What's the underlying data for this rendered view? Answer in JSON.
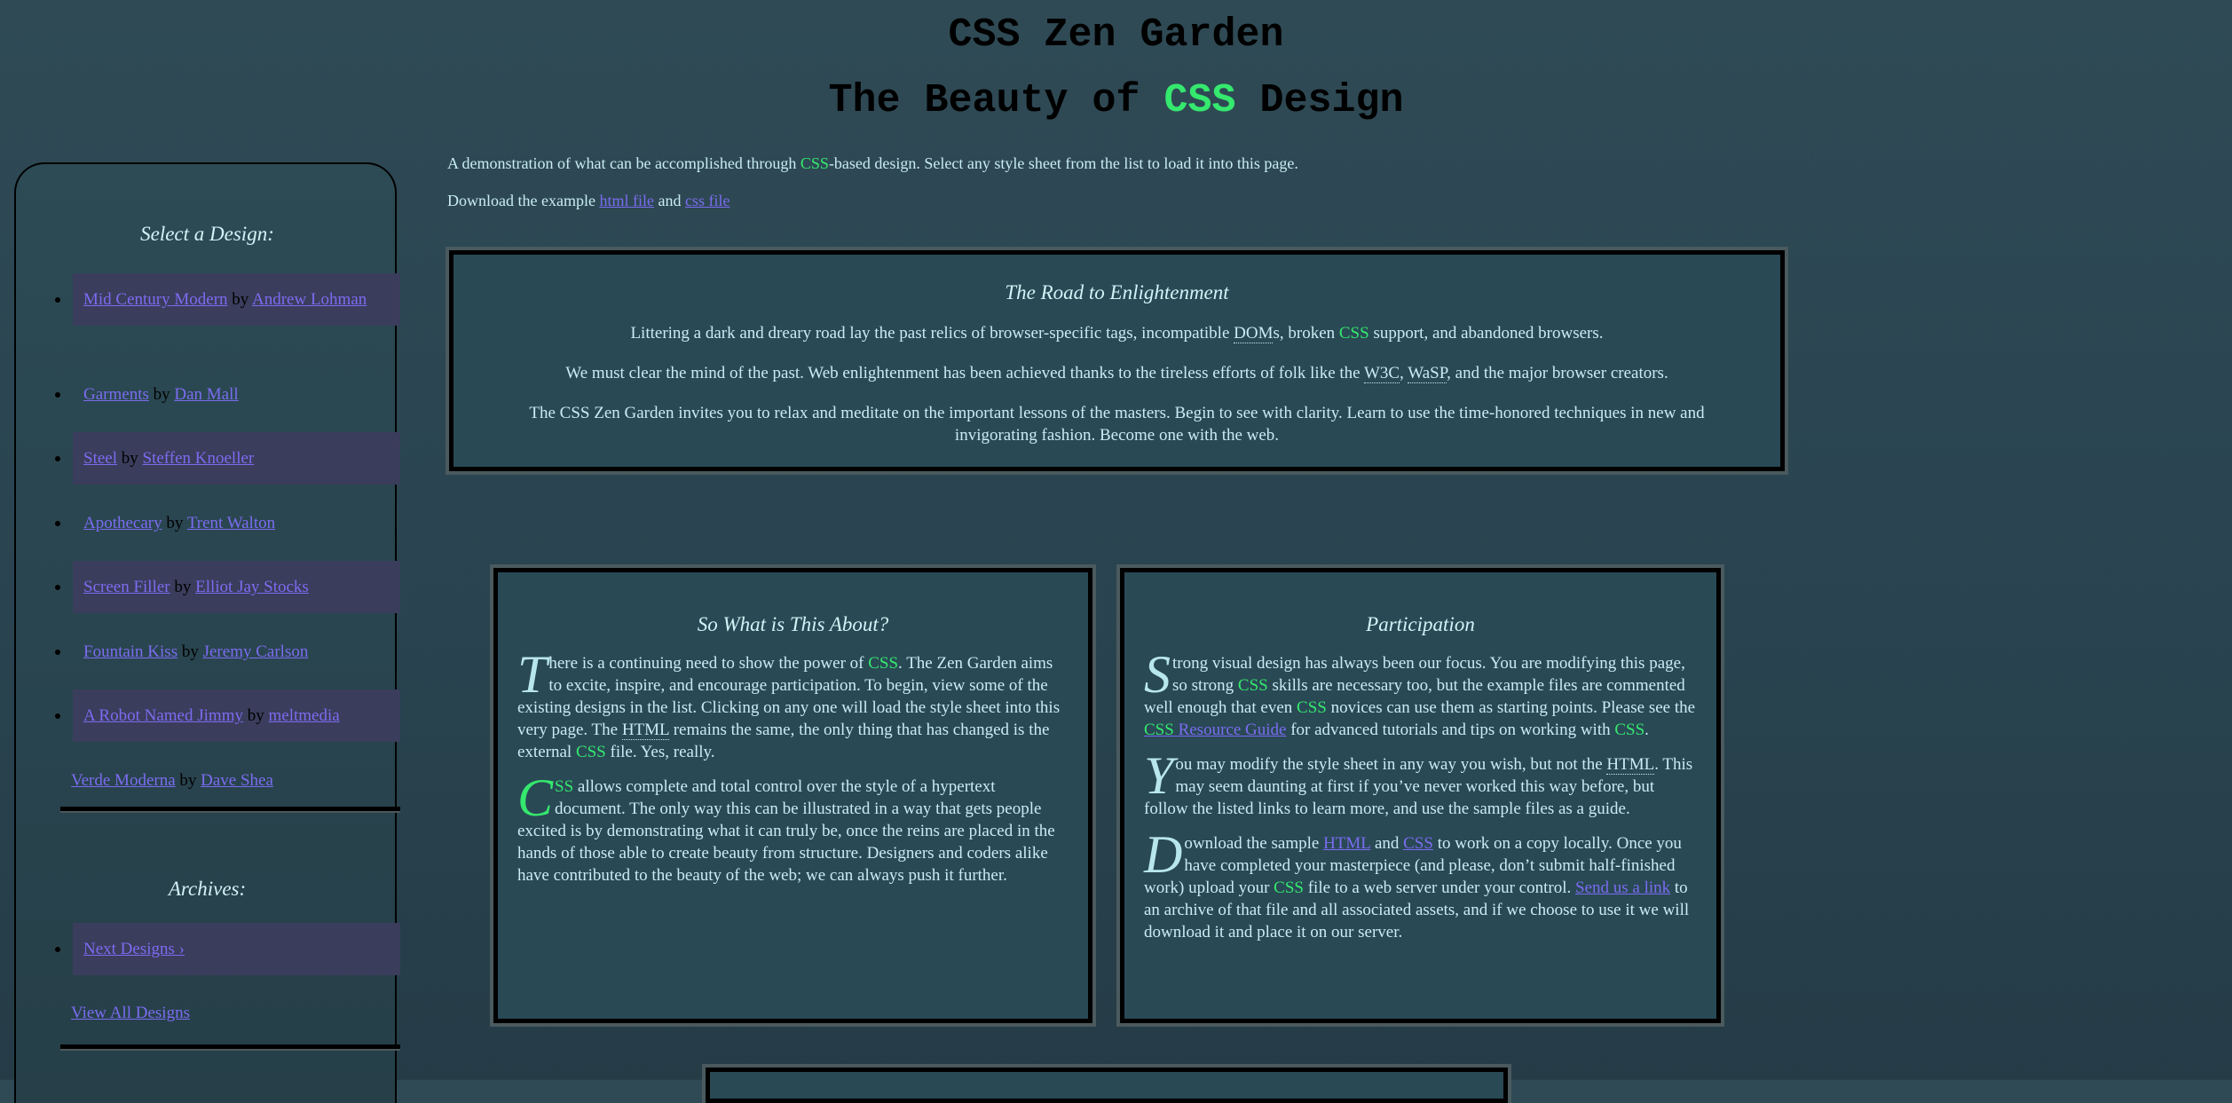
{
  "header": {
    "title": "CSS Zen Garden",
    "subtitle_pre": "The Beauty of ",
    "subtitle_css": "CSS",
    "subtitle_post": " Design"
  },
  "intro": {
    "line1_pre": "A demonstration of what can be accomplished through ",
    "line1_css": "CSS",
    "line1_post": "-based design. Select any style sheet from the list to load it into this page.",
    "line2_pre": "Download the example ",
    "html_file_link": "html file",
    "and": " and ",
    "css_file_link": "css file"
  },
  "road": {
    "title": "The Road to Enlightenment",
    "p1_pre": "Littering a dark and dreary road lay the past relics of browser-specific tags, incompatible ",
    "p1_dom": "DOM",
    "p1_mid": "s, broken ",
    "p1_css": "CSS",
    "p1_post": " support, and abandoned browsers.",
    "p2_pre": "We must clear the mind of the past. Web enlightenment has been achieved thanks to the tireless efforts of folk like the ",
    "p2_w3c": "W3C",
    "p2_comma": ", ",
    "p2_wasp": "WaSP",
    "p2_post": ", and the major browser creators.",
    "p3": "The CSS Zen Garden invites you to relax and meditate on the important lessons of the masters. Begin to see with clarity. Learn to use the time-honored techniques in new and invigorating fashion. Become one with the web."
  },
  "about": {
    "title": "So What is This About?",
    "p1_drop": "T",
    "p1_a": "here is a continuing need to show the power of ",
    "p1_css": "CSS",
    "p1_b": ". The Zen Garden aims to excite, inspire, and encourage participation. To begin, view some of the existing designs in the list. Clicking on any one will load the style sheet into this very page. The ",
    "p1_html": "HTML",
    "p1_c": " remains the same, the only thing that has changed is the external ",
    "p1_css2": "CSS",
    "p1_d": " file. Yes, really.",
    "p2_drop": "C",
    "p2_css_rest": "SS",
    "p2_a": " allows complete and total control over the style of a hypertext document. The only way this can be illustrated in a way that gets people excited is by demonstrating what it can truly be, once the reins are placed in the hands of those able to create beauty from structure. Designers and coders alike have contributed to the beauty of the web; we can always push it further."
  },
  "participation": {
    "title": "Participation",
    "p1_drop": "S",
    "p1_a": "trong visual design has always been our focus. You are modifying this page, so strong ",
    "p1_css": "CSS",
    "p1_b": " skills are necessary too, but the example files are commented well enough that even ",
    "p1_css2": "CSS",
    "p1_c": " novices can use them as starting points. Please see the ",
    "p1_link_css": "CSS",
    "p1_link_rest": " Resource Guide",
    "p1_d": " for advanced tutorials and tips on working with ",
    "p1_css3": "CSS",
    "p1_e": ".",
    "p2_drop": "Y",
    "p2_a": "ou may modify the style sheet in any way you wish, but not the ",
    "p2_html": "HTML",
    "p2_b": ". This may seem daunting at first if you’ve never worked this way before, but follow the listed links to learn more, and use the sample files as a guide.",
    "p3_drop": "D",
    "p3_a": "ownload the sample ",
    "p3_link_html": "HTML",
    "p3_and": " and ",
    "p3_link_css": "CSS",
    "p3_b": " to work on a copy locally. Once you have completed your masterpiece (and please, don’t submit half-finished work) upload your ",
    "p3_css": "CSS",
    "p3_c": " file to a web server under your control. ",
    "p3_link_send": "Send us a link",
    "p3_d": " to an archive of that file and all associated assets, and if we choose to use it we will download it and place it on our server."
  },
  "sidebar": {
    "select_title": "Select a Design:",
    "by": " by ",
    "designs": [
      {
        "name": "Mid Century Modern",
        "author": "Andrew Lohman"
      },
      {
        "name": "Garments",
        "author": "Dan Mall"
      },
      {
        "name": "Steel",
        "author": "Steffen Knoeller"
      },
      {
        "name": "Apothecary",
        "author": "Trent Walton"
      },
      {
        "name": "Screen Filler",
        "author": "Elliot Jay Stocks"
      },
      {
        "name": "Fountain Kiss",
        "author": "Jeremy Carlson"
      },
      {
        "name": "A Robot Named Jimmy",
        "author": "meltmedia"
      },
      {
        "name": "Verde Moderna",
        "author": "Dave Shea"
      }
    ],
    "archives_title": "Archives:",
    "next_designs": "Next Designs ›",
    "view_all": "View All Designs"
  },
  "colors": {
    "background": "#2b4752",
    "accent_css": "#35e86e",
    "link": "#7b6cf0",
    "text": "#c9ecf2",
    "shade_item": "#3a3d5c"
  }
}
